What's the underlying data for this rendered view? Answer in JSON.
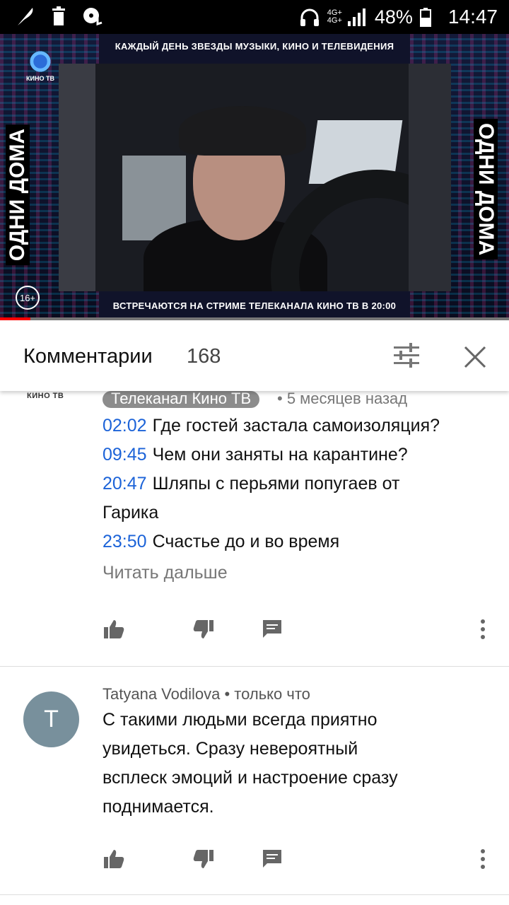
{
  "status_bar": {
    "network_top": "4G+",
    "network_top2": "4G+",
    "battery": "48%",
    "time": "14:47"
  },
  "video": {
    "top_banner": "КАЖДЫЙ ДЕНЬ ЗВЕЗДЫ МУЗЫКИ, КИНО И ТЕЛЕВИДЕНИЯ",
    "bottom_banner": "ВСТРЕЧАЮТСЯ НА СТРИМЕ ТЕЛЕКАНАЛА КИНО ТВ В 20:00",
    "logo_text": "КИНО ТВ",
    "side_title": "ОДНИ ДОМА",
    "age_rating": "16+",
    "progress_fraction": 0.06
  },
  "comments_header": {
    "title": "Комментарии",
    "count": "168"
  },
  "comments": [
    {
      "channel_tag": "КИНО ТВ",
      "author": "Телеканал Кино ТВ",
      "time": "• 5 месяцев назад",
      "lines": [
        {
          "timestamp": "02:02",
          "text": "Где гостей застала самоизоляция?"
        },
        {
          "timestamp": "09:45",
          "text": "Чем они заняты на карантине?"
        },
        {
          "timestamp": "20:47",
          "text": "Шляпы с перьями попугаев от"
        },
        {
          "timestamp": "",
          "text": "Гарика"
        },
        {
          "timestamp": "23:50",
          "text": "Счастье до и во время"
        }
      ],
      "read_more": "Читать дальше"
    },
    {
      "avatar_letter": "T",
      "author": "Tatyana Vodilova • только что",
      "lines": [
        "С такими людьми всегда приятно",
        "увидеться. Сразу невероятный",
        "всплеск эмоций и настроение сразу",
        "поднимается."
      ]
    }
  ],
  "colors": {
    "timestamp_link": "#1c63d8",
    "avatar_bg": "#78909c",
    "progress": "#ff0000"
  },
  "icons": [
    "feather-icon",
    "trash-icon",
    "music-disc-icon",
    "headphones-icon",
    "signal-icon",
    "battery-icon",
    "filter-icon",
    "close-icon",
    "thumb-up-icon",
    "thumb-down-icon",
    "reply-icon",
    "more-vert-icon"
  ]
}
